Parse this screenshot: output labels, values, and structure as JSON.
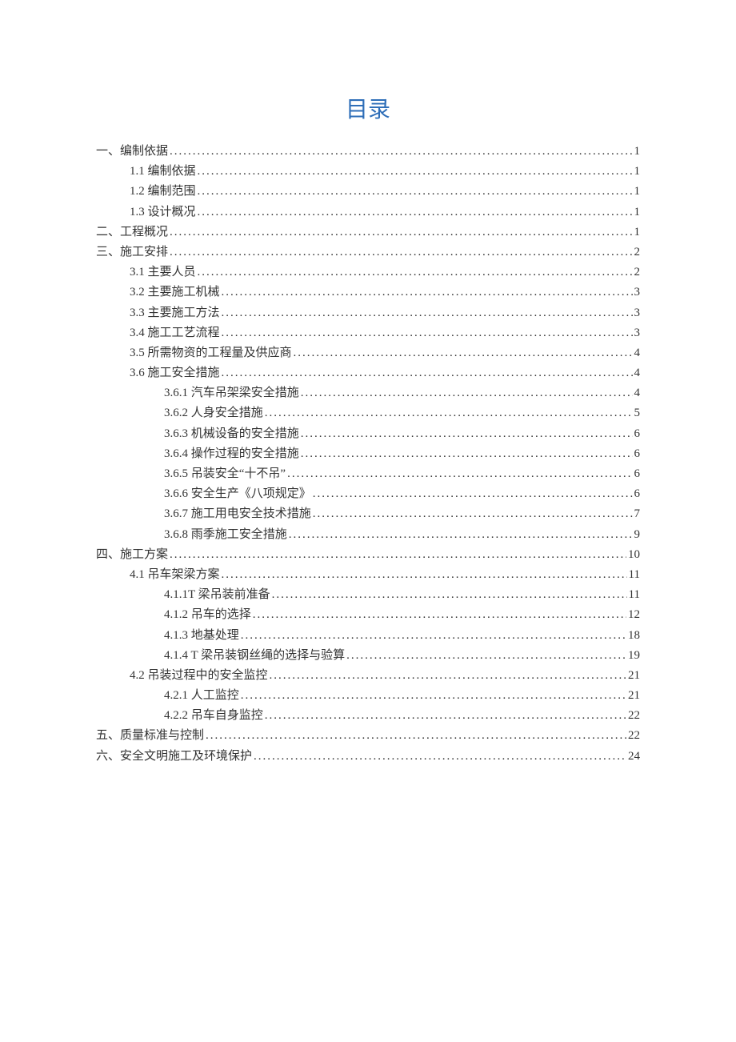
{
  "title": "目录",
  "entries": [
    {
      "level": 0,
      "label": "一、编制依据",
      "page": "1"
    },
    {
      "level": 1,
      "label": "1.1 编制依据",
      "page": "1"
    },
    {
      "level": 1,
      "label": "1.2 编制范围",
      "page": "1"
    },
    {
      "level": 1,
      "label": "1.3 设计概况",
      "page": "1"
    },
    {
      "level": 0,
      "label": "二、工程概况",
      "page": "1"
    },
    {
      "level": 0,
      "label": "三、施工安排",
      "page": "2"
    },
    {
      "level": 1,
      "label": "3.1 主要人员",
      "page": "2"
    },
    {
      "level": 1,
      "label": "3.2 主要施工机械",
      "page": "3"
    },
    {
      "level": 1,
      "label": "3.3 主要施工方法",
      "page": "3"
    },
    {
      "level": 1,
      "label": "3.4 施工工艺流程",
      "page": "3"
    },
    {
      "level": 1,
      "label": "3.5 所需物资的工程量及供应商",
      "page": "4"
    },
    {
      "level": 1,
      "label": "3.6 施工安全措施",
      "page": "4"
    },
    {
      "level": 2,
      "label": "3.6.1 汽车吊架梁安全措施",
      "page": "4"
    },
    {
      "level": 2,
      "label": "3.6.2 人身安全措施",
      "page": "5"
    },
    {
      "level": 2,
      "label": "3.6.3 机械设备的安全措施",
      "page": "6"
    },
    {
      "level": 2,
      "label": "3.6.4 操作过程的安全措施",
      "page": "6"
    },
    {
      "level": 2,
      "label": "3.6.5 吊装安全“十不吊”",
      "page": "6"
    },
    {
      "level": 2,
      "label": "3.6.6 安全生产《八项规定》",
      "page": "6"
    },
    {
      "level": 2,
      "label": "3.6.7 施工用电安全技术措施",
      "page": "7"
    },
    {
      "level": 2,
      "label": "3.6.8 雨季施工安全措施",
      "page": "9"
    },
    {
      "level": 0,
      "label": "四、施工方案",
      "page": "10"
    },
    {
      "level": 1,
      "label": "4.1 吊车架梁方案",
      "page": "11"
    },
    {
      "level": 2,
      "label": "4.1.1T 梁吊装前准备",
      "page": "11"
    },
    {
      "level": 2,
      "label": "4.1.2 吊车的选择",
      "page": "12"
    },
    {
      "level": 2,
      "label": "4.1.3 地基处理",
      "page": "18"
    },
    {
      "level": 2,
      "label": "4.1.4 T 梁吊装钢丝绳的选择与验算",
      "page": "19"
    },
    {
      "level": 1,
      "label": "4.2 吊装过程中的安全监控",
      "page": "21"
    },
    {
      "level": 2,
      "label": "4.2.1 人工监控",
      "page": "21"
    },
    {
      "level": 2,
      "label": "4.2.2 吊车自身监控",
      "page": "22"
    },
    {
      "level": 0,
      "label": "五、质量标准与控制",
      "page": "22"
    },
    {
      "level": 0,
      "label": "六、安全文明施工及环境保护",
      "page": "24"
    }
  ]
}
